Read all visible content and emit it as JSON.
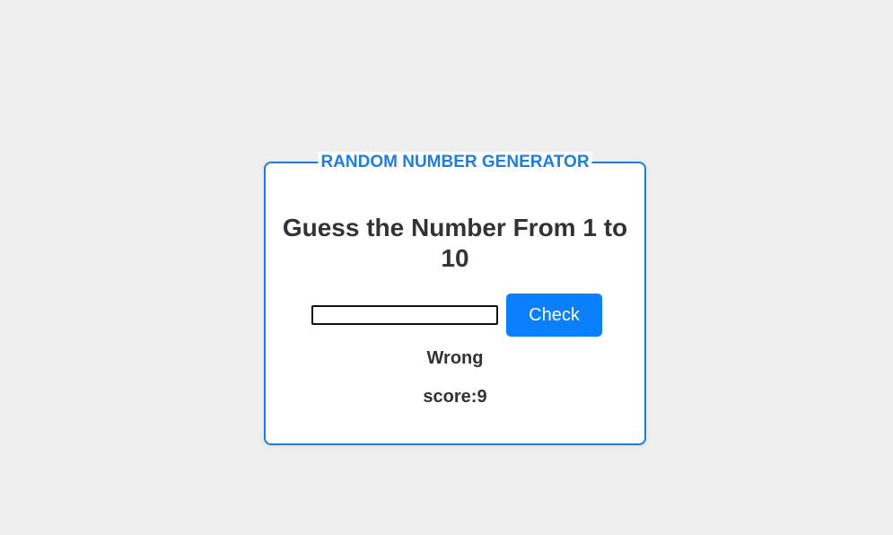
{
  "card": {
    "legend": "RANDOM NUMBER GENERATOR",
    "title": "Guess the Number From 1 to 10"
  },
  "form": {
    "input_value": "",
    "check_label": "Check"
  },
  "result": {
    "message": "Wrong",
    "score_label": "score:",
    "score_value": "9"
  },
  "colors": {
    "accent": "#1c7fe0",
    "button": "#0a80ff",
    "background": "#efefef",
    "text": "#333333"
  }
}
